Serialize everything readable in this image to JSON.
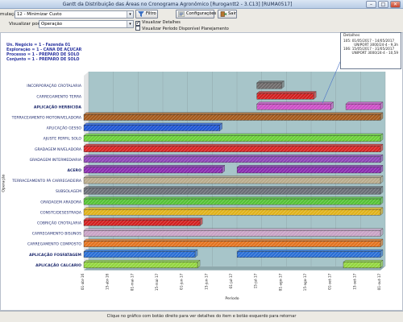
{
  "window": {
    "title": "Gantt da Distribuição das Áreas no Cronograma Agronômico [Rurogantt2 - 3.C13] [RUMA0517]",
    "minimize_glyph": "–",
    "maximize_glyph": "□",
    "close_glyph": "✕"
  },
  "controls": {
    "simulacao_label": "mulação",
    "simulacao_value": "12 - Minimizar Custo",
    "visualizar_label": "Visualizar por",
    "visualizar_value": "Operação",
    "combo_arrow": "▾",
    "filtro_label": "Filtro",
    "configuracoes_label": "Configurações",
    "sair_label": "Sair",
    "visualizar_detalhes_label": "Visualizar Detalhes",
    "visualizar_detalhes_checked": true,
    "visualizar_periodo_label": "Visualizar Período Disponível Planejamento",
    "visualizar_periodo_checked": false,
    "check_mark": "✔"
  },
  "hierarchy": [
    "Un. Negócio = 1 - Fazenda 01",
    "Exploração = 1 - CANA DE AÇUCAR",
    "Processo = 1 - PREPARO DE SOLO",
    "Conjunto = 1 - PREPARO DE SOLO"
  ],
  "details": {
    "title": "Detalhes",
    "lines": [
      "105: 01/05/2017 - 14/05/2017",
      "UNIPORT 3000/24-4 - 9,3h",
      "",
      "106: 15/05/2017 - 31/05/2017",
      "UNIPORT 3000/24-4 - 10,59"
    ]
  },
  "status_text": "Clique no gráfico com botão direito para ver detalhes do item e botão esquerdo para retornar",
  "colors": {
    "plot_back": "#a7c5c9",
    "plot_floor": "#8ea9ad",
    "label_side": "#e3e5e6",
    "label_text": "#1e2a6e"
  },
  "chart_data": {
    "type": "bar",
    "orientation": "horizontal",
    "title": "",
    "xlabel": "Período",
    "ylabel": "Operação",
    "x_ticks": [
      "01-abr-16",
      "15-abr-16",
      "01-mai-17",
      "15-mai-17",
      "01-jun-17",
      "15-jun-17",
      "01-jul-17",
      "15-jul-17",
      "01-ago-17",
      "15-ago-17",
      "01-set-17",
      "15-set-17",
      "01-out-17"
    ],
    "grid": true,
    "categories": [
      {
        "label": "INCORPORAÇÃO CROTALARIA",
        "bold": false,
        "color": "#6e6a6a",
        "segments": [
          [
            7.0,
            8.0
          ]
        ]
      },
      {
        "label": "CARREGAMENTO TERRA",
        "bold": false,
        "color": "#d11f1f",
        "segments": [
          [
            7.0,
            9.3
          ]
        ]
      },
      {
        "label": "APLICAÇÃO HERBICIDA",
        "bold": true,
        "color": "#cc4fc6",
        "segments": [
          [
            7.0,
            10.0
          ],
          [
            10.6,
            12.0
          ]
        ]
      },
      {
        "label": "TERRACEAMENTO MOTONIVELADORA",
        "bold": false,
        "color": "#a55a1c",
        "segments": [
          [
            0.0,
            12.0
          ]
        ]
      },
      {
        "label": "APLICAÇÃO GESSO",
        "bold": false,
        "color": "#1f56d4",
        "segments": [
          [
            0.0,
            5.5
          ]
        ]
      },
      {
        "label": "AJUSTE PERFIL SOLO",
        "bold": false,
        "color": "#6bd037",
        "segments": [
          [
            0.0,
            12.0
          ]
        ]
      },
      {
        "label": "GRADAGEM NIVELADORA",
        "bold": false,
        "color": "#d92424",
        "segments": [
          [
            0.0,
            12.0
          ]
        ]
      },
      {
        "label": "GRADAGEM INTERMEDIARIA",
        "bold": false,
        "color": "#8e46b8",
        "segments": [
          [
            0.0,
            12.0
          ]
        ]
      },
      {
        "label": "ACERO",
        "bold": true,
        "color": "#8a2bb0",
        "segments": [
          [
            0.0,
            5.6
          ],
          [
            6.2,
            12.0
          ]
        ]
      },
      {
        "label": "TERRACEAMENTO PÁ CARREGADEIRA",
        "bold": false,
        "color": "#b9ab8c",
        "segments": [
          [
            0.0,
            12.0
          ]
        ]
      },
      {
        "label": "SUBSOLAGEM",
        "bold": false,
        "color": "#6a6e76",
        "segments": [
          [
            0.0,
            12.0
          ]
        ]
      },
      {
        "label": "GRADAGEM ARADORA",
        "bold": false,
        "color": "#55c235",
        "segments": [
          [
            0.0,
            12.0
          ]
        ]
      },
      {
        "label": "CONSTC/DESESTRADA",
        "bold": false,
        "color": "#e0b21a",
        "segments": [
          [
            0.0,
            12.0
          ]
        ]
      },
      {
        "label": "COBRIÇÃO CROTALARIA",
        "bold": false,
        "color": "#d21f1f",
        "segments": [
          [
            0.0,
            4.7
          ]
        ]
      },
      {
        "label": "CARREGAMENTO BISUNOS",
        "bold": false,
        "color": "#c9a3c6",
        "segments": [
          [
            0.0,
            12.0
          ]
        ]
      },
      {
        "label": "CARREGAMENTO COMPOSTO",
        "bold": false,
        "color": "#e3731f",
        "segments": [
          [
            0.0,
            12.0
          ]
        ]
      },
      {
        "label": "APLICAÇÃO FOSFATAGEM",
        "bold": true,
        "color": "#2a6fd6",
        "segments": [
          [
            0.0,
            4.5
          ],
          [
            6.2,
            12.0
          ]
        ]
      },
      {
        "label": "APLICAÇÃO CALCARIO",
        "bold": true,
        "color": "#93d63f",
        "segments": [
          [
            0.0,
            4.6
          ],
          [
            10.5,
            12.0
          ]
        ]
      }
    ]
  }
}
